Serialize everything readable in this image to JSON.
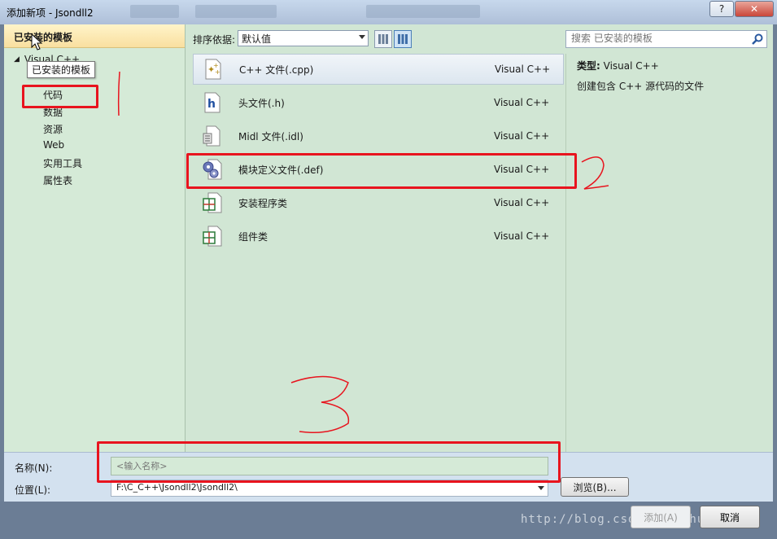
{
  "window": {
    "title": "添加新项 - Jsondll2",
    "help": "?",
    "close": "✕"
  },
  "left_pane": {
    "header": "已安装的模板",
    "root": "Visual C++",
    "tooltip": "已安装的模板",
    "items": [
      "代码",
      "数据",
      "资源",
      "Web",
      "实用工具",
      "属性表"
    ]
  },
  "toolbar": {
    "sort_label": "排序依据:",
    "sort_value": "默认值",
    "search_placeholder": "搜索 已安装的模板"
  },
  "templates": [
    {
      "name": "C++ 文件(.cpp)",
      "lang": "Visual C++",
      "icon": "cpp-file-icon"
    },
    {
      "name": "头文件(.h)",
      "lang": "Visual C++",
      "icon": "header-file-icon"
    },
    {
      "name": "Midl 文件(.idl)",
      "lang": "Visual C++",
      "icon": "midl-file-icon"
    },
    {
      "name": "模块定义文件(.def)",
      "lang": "Visual C++",
      "icon": "def-file-icon"
    },
    {
      "name": "安装程序类",
      "lang": "Visual C++",
      "icon": "installer-class-icon"
    },
    {
      "name": "组件类",
      "lang": "Visual C++",
      "icon": "component-class-icon"
    }
  ],
  "info": {
    "type_label": "类型:",
    "type_value": "Visual C++",
    "description": "创建包含 C++ 源代码的文件"
  },
  "form": {
    "name_label": "名称(N):",
    "name_placeholder": "<输入名称>",
    "location_label": "位置(L):",
    "location_value": "F:\\C_C++\\Jsondll2\\Jsondll2\\",
    "browse_label": "浏览(B)..."
  },
  "footer": {
    "add_label": "添加(A)",
    "cancel_label": "取消",
    "watermark": "http://blog.csdn.net/zhuizhe"
  },
  "colors": {
    "annotation_red": "#e8141e",
    "pane_green": "#d1e6d4"
  }
}
